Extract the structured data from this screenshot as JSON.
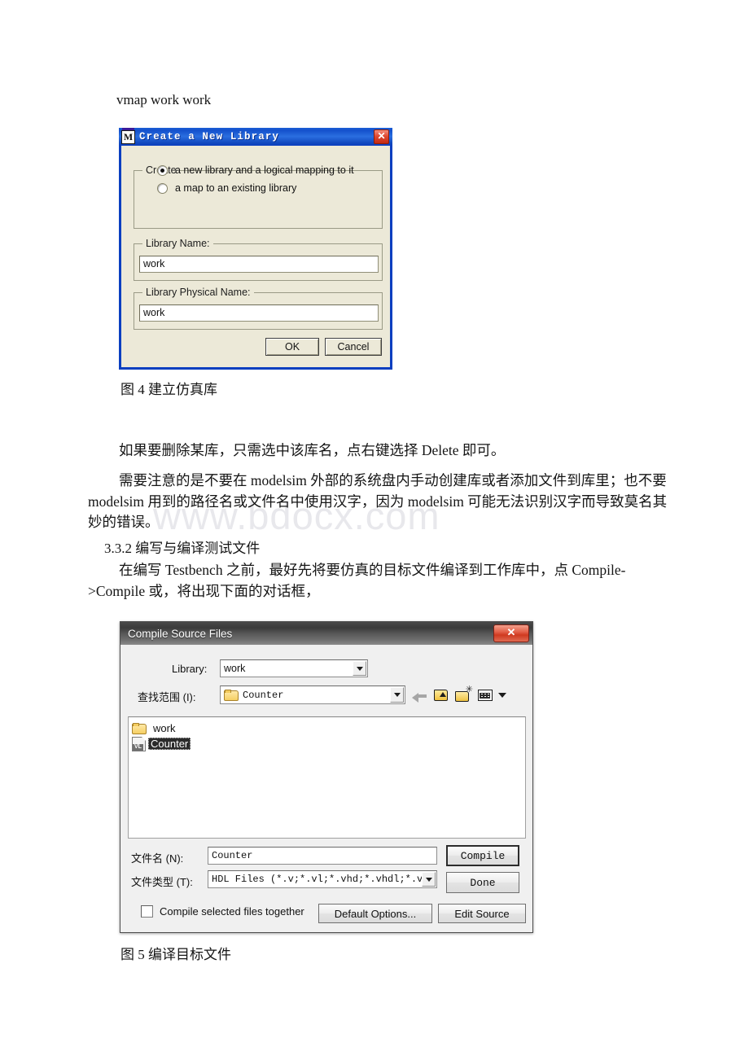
{
  "document": {
    "command_line": "vmap work work",
    "caption_fig4": "图 4 建立仿真库",
    "para_delete": "如果要删除某库，只需选中该库名，点右键选择 Delete 即可。",
    "para_note": "需要注意的是不要在 modelsim 外部的系统盘内手动创建库或者添加文件到库里；也不要 modelsim 用到的路径名或文件名中使用汉字，因为 modelsim 可能无法识别汉字而导致莫名其妙的错误。",
    "heading_332": "3.3.2 编写与编译测试文件",
    "para_testbench": "在编写 Testbench 之前，最好先将要仿真的目标文件编译到工作库中，点 Compile->Compile 或，将出现下面的对话框，",
    "caption_fig5": "图 5 编译目标文件",
    "watermark": "www.bdocx.com"
  },
  "dialog_create_library": {
    "title": "Create a New Library",
    "app_icon": "M",
    "close_label": "✕",
    "group_create_label": "Create",
    "radios": [
      {
        "label": "a new library and a logical mapping to it",
        "selected": true
      },
      {
        "label": "a map to an existing library",
        "selected": false
      }
    ],
    "library_name": {
      "group_label": "Library Name:",
      "value": "work"
    },
    "library_physical_name": {
      "group_label": "Library Physical Name:",
      "value": "work"
    },
    "buttons": {
      "ok": "OK",
      "cancel": "Cancel"
    },
    "colors": {
      "titlebar": "#1450cc",
      "face": "#ece9d8",
      "close": "#cf3a20"
    }
  },
  "dialog_compile_source_files": {
    "title": "Compile Source Files",
    "close_label": "✕",
    "library": {
      "label": "Library:",
      "value": "work"
    },
    "look_in": {
      "label": "查找范围 (I):",
      "value": "Counter"
    },
    "toolbar": {
      "back": "back-arrow",
      "up_folder": "up-one-level",
      "new_folder": "create-new-folder",
      "views": "views-menu"
    },
    "file_list": [
      {
        "name": "work",
        "type": "folder",
        "selected": false
      },
      {
        "name": "Counter",
        "type": "verilog-file",
        "selected": true
      }
    ],
    "file_name": {
      "label": "文件名 (N):",
      "value": "Counter"
    },
    "file_type": {
      "label": "文件类型 (T):",
      "value": "HDL Files (*.v;*.vl;*.vhd;*.vhdl;*.v"
    },
    "compile_together": {
      "label": "Compile selected files together",
      "checked": false
    },
    "buttons": {
      "compile": "Compile",
      "done": "Done",
      "default_options": "Default Options...",
      "edit_source": "Edit Source"
    },
    "colors": {
      "titlebar": "#5b5b5b",
      "face": "#f0f0f0",
      "close": "#cf3a20",
      "selection": "#2b2b2b"
    }
  }
}
